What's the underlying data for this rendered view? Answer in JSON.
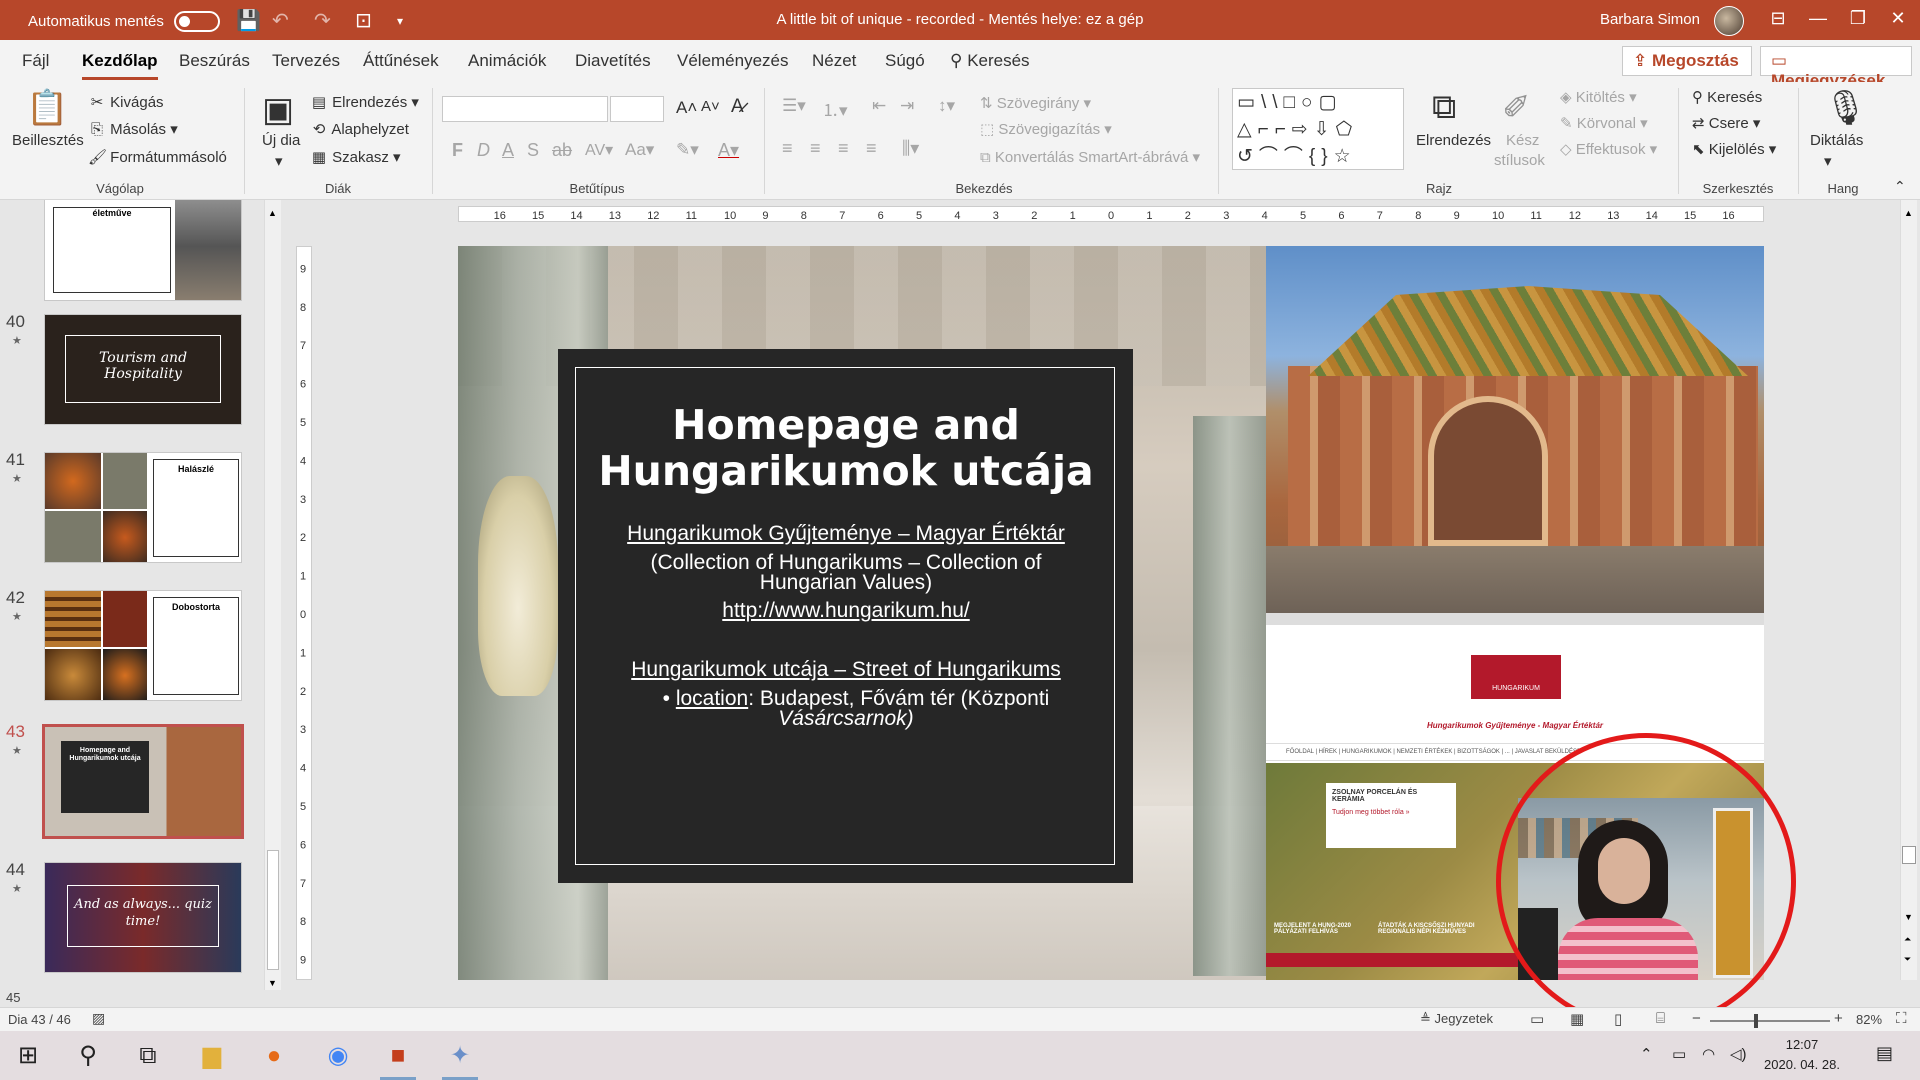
{
  "titlebar": {
    "autosave_label": "Automatikus mentés",
    "autosave_state": "off",
    "document_title": "A little bit of unique - recorded  -  Mentés helye: ez a gép",
    "user_name": "Barbara Simon",
    "accent_color": "#b7472a"
  },
  "menu": {
    "tabs": [
      "Fájl",
      "Kezdőlap",
      "Beszúrás",
      "Tervezés",
      "Áttűnések",
      "Animációk",
      "Diavetítés",
      "Véleményezés",
      "Nézet",
      "Súgó",
      "Keresés"
    ],
    "active_tab": "Kezdőlap",
    "share": "Megosztás",
    "comments": "Megjegyzések"
  },
  "ribbon": {
    "vagolap": {
      "label": "Vágólap",
      "paste": "Beillesztés",
      "cut": "Kivágás",
      "copy": "Másolás",
      "format_painter": "Formátummásoló"
    },
    "diak": {
      "label": "Diák",
      "new_slide_1": "Új dia",
      "layout": "Elrendezés",
      "reset": "Alaphelyzet",
      "section": "Szakasz"
    },
    "betutipus": {
      "label": "Betűtípus",
      "font_name": "",
      "font_size": ""
    },
    "bekezdes": {
      "label": "Bekezdés",
      "text_direction": "Szövegirány",
      "align_text": "Szövegigazítás",
      "smartart": "Konvertálás SmartArt-ábrává"
    },
    "rajz": {
      "label": "Rajz",
      "arrange": "Elrendezés",
      "quick_styles_1": "Kész",
      "quick_styles_2": "stílusok",
      "fill": "Kitöltés",
      "outline": "Körvonal",
      "effects": "Effektusok"
    },
    "szerkesztes": {
      "label": "Szerkesztés",
      "find": "Keresés",
      "replace": "Csere",
      "select": "Kijelölés"
    },
    "hang": {
      "label": "Hang",
      "dictate": "Diktálás"
    }
  },
  "thumbnails": [
    {
      "num": "",
      "title": "életműve"
    },
    {
      "num": "40",
      "title": "Tourism and Hospitality"
    },
    {
      "num": "41",
      "title": "Halászlé"
    },
    {
      "num": "42",
      "title": "Dobostorta"
    },
    {
      "num": "43",
      "title": "Homepage and Hungarikumok utcája",
      "selected": true
    },
    {
      "num": "44",
      "title": "And as always... quiz time!"
    },
    {
      "num": "45",
      "title": ""
    }
  ],
  "slide": {
    "title_line1": "Homepage and",
    "title_line2": "Hungarikumok utcája",
    "link1": "Hungarikumok Gyűjteménye – Magyar Értéktár",
    "link1_en_line1": "(Collection of Hungarikums – Collection of",
    "link1_en_line2": "Hungarian Values)",
    "url": "http://www.hungarikum.hu/",
    "link2": "Hungarikumok utcája – Street of Hungarikums",
    "bullet_label": "location",
    "bullet_rest_line1": ": Budapest, Fővám tér (Központi",
    "bullet_rest_line2": "Vásárcsarnok)",
    "website": {
      "logo_text": "HUNGARIKUM",
      "heading": "Hungarikumok Gyűjteménye - Magyar Értéktár",
      "nav": "FŐOLDAL | HÍREK | HUNGARIKUMOK | NEMZETI ÉRTÉKEK | BIZOTTSÁGOK | ... | JAVASLAT BEKÜLDÉSE",
      "card_title": "ZSOLNAY PORCELÁN ÉS KERÁMIA",
      "card_link": "Tudjon meg többet róla »",
      "news1": "MEGJELENT A HUNG-2020 PÁLYÁZATI FELHÍVÁS",
      "news2": "ÁTADTÁK A KISCSŐSZI HUNYADI REGIONÁLIS NÉPI KÉZMŰVES"
    }
  },
  "status": {
    "slide_counter": "Dia 43 / 46",
    "notes": "Jegyzetek",
    "zoom": "82%"
  },
  "taskbar": {
    "time": "12:07",
    "date": "2020. 04. 28."
  }
}
